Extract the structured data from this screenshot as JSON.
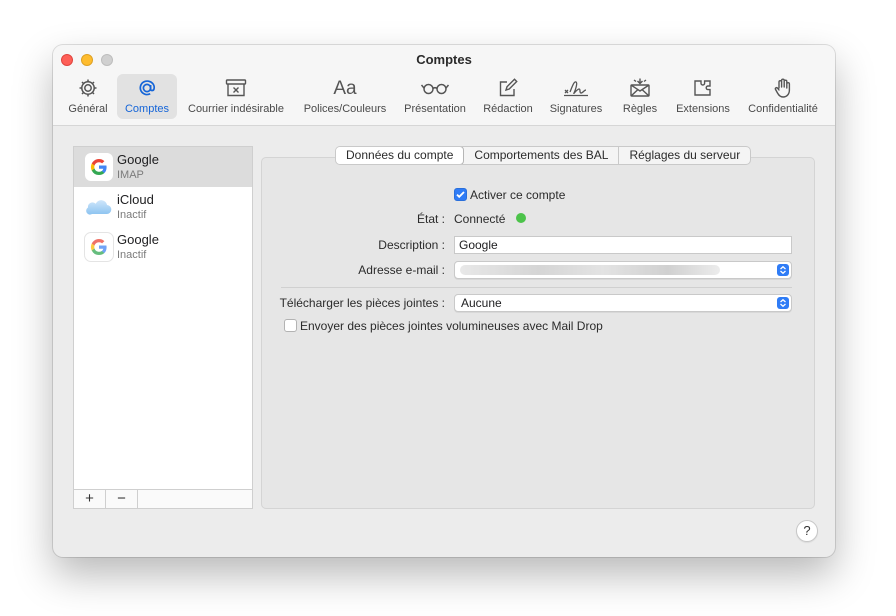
{
  "window": {
    "title": "Comptes"
  },
  "toolbar": {
    "items": [
      {
        "label": "Général",
        "icon": "gear-icon"
      },
      {
        "label": "Comptes",
        "icon": "at-sign-icon",
        "active": true
      },
      {
        "label": "Courrier indésirable",
        "icon": "junk-mail-icon"
      },
      {
        "label": "Polices/Couleurs",
        "icon": "font-icon",
        "glyph": "Aa"
      },
      {
        "label": "Présentation",
        "icon": "glasses-icon"
      },
      {
        "label": "Rédaction",
        "icon": "compose-icon"
      },
      {
        "label": "Signatures",
        "icon": "signature-icon"
      },
      {
        "label": "Règles",
        "icon": "rules-icon"
      },
      {
        "label": "Extensions",
        "icon": "puzzle-icon"
      },
      {
        "label": "Confidentialité",
        "icon": "hand-icon"
      }
    ]
  },
  "accounts": [
    {
      "name": "Google",
      "status": "IMAP",
      "icon": "google-icon",
      "selected": true
    },
    {
      "name": "iCloud",
      "status": "Inactif",
      "icon": "icloud-icon"
    },
    {
      "name": "Google",
      "status": "Inactif",
      "icon": "google-icon"
    }
  ],
  "list_footer": {
    "add": "+",
    "remove": "−"
  },
  "tabs": [
    {
      "label": "Données du compte",
      "active": true
    },
    {
      "label": "Comportements des BAL"
    },
    {
      "label": "Réglages du serveur"
    }
  ],
  "form": {
    "enable_label": "Activer ce compte",
    "enable_checked": true,
    "state_label": "État :",
    "state_value": "Connecté",
    "state_color": "#4cc34a",
    "description_label": "Description :",
    "description_value": "Google",
    "email_label": "Adresse e-mail :",
    "attachments_label": "Télécharger les pièces jointes :",
    "attachments_value": "Aucune",
    "maildrop_label": "Envoyer des pièces jointes volumineuses avec Mail Drop",
    "maildrop_checked": false
  },
  "help": {
    "label": "?"
  },
  "colors": {
    "accent": "#2f7cf6",
    "selection": "#dcdcdc"
  }
}
